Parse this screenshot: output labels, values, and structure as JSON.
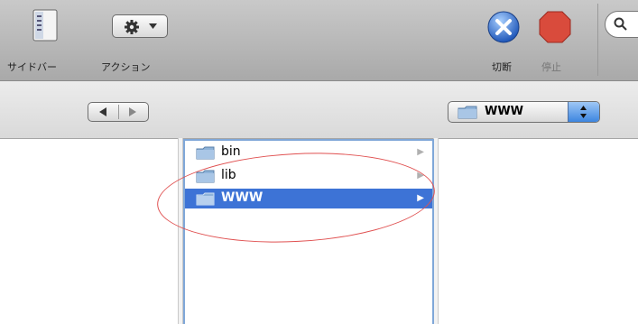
{
  "toolbar": {
    "sidebar_label": "サイドバー",
    "action_label": "アクション",
    "disconnect_label": "切断",
    "stop_label": "停止"
  },
  "pathbar": {
    "current_folder": "WWW"
  },
  "files": [
    {
      "name": "bin",
      "selected": false
    },
    {
      "name": "lib",
      "selected": false
    },
    {
      "name": "WWW",
      "selected": true
    }
  ],
  "colors": {
    "selection": "#3d73d6",
    "annotation_circle": "#e05050",
    "stop_red": "#d94b3c",
    "disconnect_blue": "#2f6fd6"
  }
}
